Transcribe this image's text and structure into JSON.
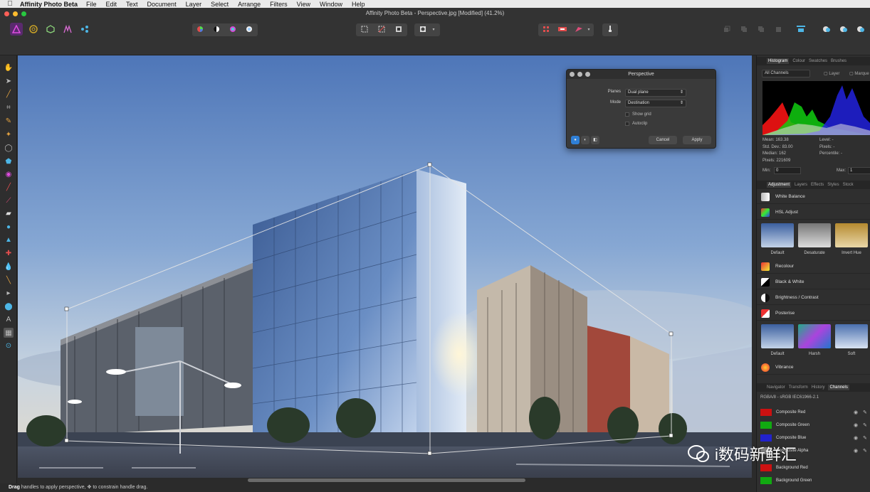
{
  "menubar": {
    "app_name": "Affinity Photo Beta",
    "items": [
      "File",
      "Edit",
      "Text",
      "Document",
      "Layer",
      "Select",
      "Arrange",
      "Filters",
      "View",
      "Window",
      "Help"
    ]
  },
  "window": {
    "title": "Affinity Photo Beta - Perspective.jpg [Modified] (41.2%)"
  },
  "personas": [
    "photo-persona-icon",
    "liquify-persona-icon",
    "develop-persona-icon",
    "tone-mapping-persona-icon",
    "export-persona-icon"
  ],
  "status": {
    "bold": "Drag",
    "rest": "handles to apply perspective, ✥ to constrain handle drag."
  },
  "dialog": {
    "title": "Perspective",
    "planes_label": "Planes",
    "planes_value": "Dual plane",
    "mode_label": "Mode",
    "mode_value": "Destination",
    "show_grid": "Show grid",
    "autoclip": "Autoclip",
    "cancel": "Cancel",
    "apply": "Apply"
  },
  "histogram_panel": {
    "tabs": [
      "Histogram",
      "Colour",
      "Swatches",
      "Brushes"
    ],
    "channels": "All Channels",
    "layer": "Layer",
    "marquee": "Marque",
    "mean": "Mean: 163.38",
    "std_dev": "Std. Dev.: 83.00",
    "median": "Median: 162",
    "pixels": "Pixels: 221609",
    "level": "Level: -",
    "pixels_r": "Pixels: -",
    "percentile": "Percentile: -",
    "min_label": "Min:",
    "min_value": "0",
    "max_label": "Max:",
    "max_value": "1"
  },
  "adjustment_panel": {
    "tabs": [
      "Adjustment",
      "Layers",
      "Effects",
      "Styles",
      "Stock"
    ],
    "white_balance": "White Balance",
    "hsl": "HSL Adjust",
    "hsl_presets": [
      "Default",
      "Desaturate",
      "Invert Hue"
    ],
    "recolour": "Recolour",
    "black_white": "Black & White",
    "brightness": "Brightness / Contrast",
    "posterise": "Posterise",
    "posterise_presets": [
      "Default",
      "Harsh",
      "Soft"
    ],
    "vibrance": "Vibrance"
  },
  "channels_panel": {
    "tabs": [
      "Navigator",
      "Transform",
      "History",
      "Channels"
    ],
    "profile": "RGBA/8 - sRGB IEC61966-2.1",
    "items": [
      "Composite Red",
      "Composite Green",
      "Composite Blue",
      "Composite Alpha",
      "Background Red",
      "Background Green"
    ]
  },
  "watermark": {
    "text": "i数码新鲜汇"
  },
  "colors": {
    "accent": "#2f7fd6",
    "toolbar": "#333333",
    "panel": "#2f2f2f"
  }
}
